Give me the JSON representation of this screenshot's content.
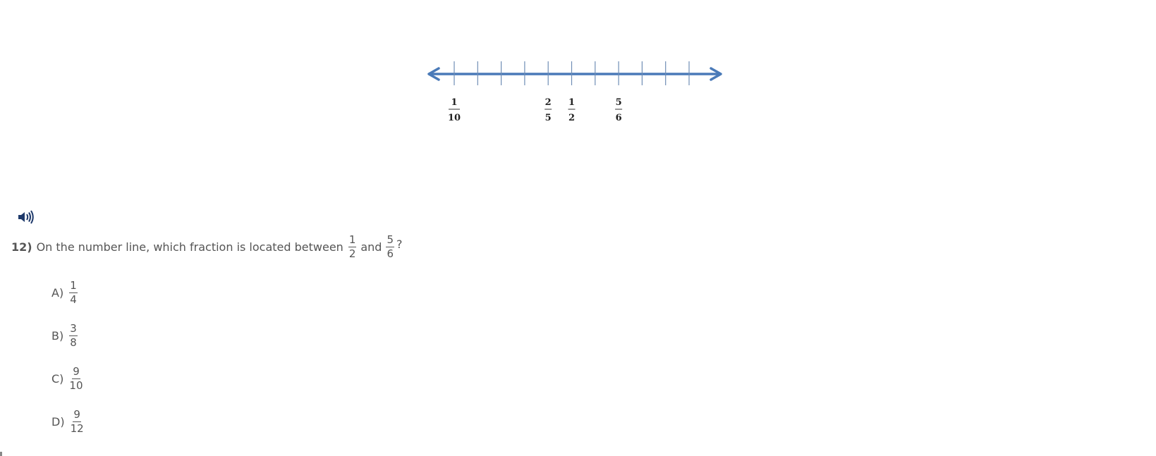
{
  "number_line": {
    "tick_count": 11,
    "labels": [
      {
        "tick_index": 0,
        "numerator": "1",
        "denominator": "10"
      },
      {
        "tick_index": 4,
        "numerator": "2",
        "denominator": "5"
      },
      {
        "tick_index": 5,
        "numerator": "1",
        "denominator": "2"
      },
      {
        "tick_index": 7,
        "numerator": "5",
        "denominator": "6"
      }
    ],
    "color": "#4a7ab8"
  },
  "audio": {
    "icon": "speaker-icon",
    "color": "#1f3a6b"
  },
  "question": {
    "number": "12)",
    "text_before": "On the number line, which fraction is located between",
    "frac1": {
      "n": "1",
      "d": "2"
    },
    "connector": "and",
    "frac2": {
      "n": "5",
      "d": "6"
    },
    "text_after": "?"
  },
  "choices": [
    {
      "letter": "A)",
      "n": "1",
      "d": "4"
    },
    {
      "letter": "B)",
      "n": "3",
      "d": "8"
    },
    {
      "letter": "C)",
      "n": "9",
      "d": "10"
    },
    {
      "letter": "D)",
      "n": "9",
      "d": "12"
    }
  ]
}
